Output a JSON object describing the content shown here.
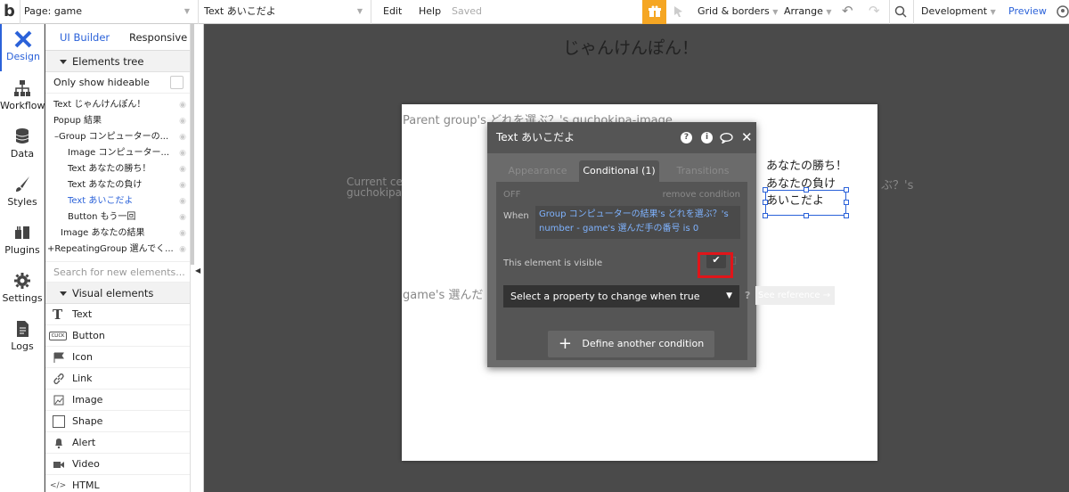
{
  "topbar": {
    "logo": "b",
    "page_label": "Page: game",
    "element_label": "Text あいこだよ",
    "edit": "Edit",
    "help": "Help",
    "saved": "Saved",
    "grid": "Grid & borders",
    "arrange": "Arrange",
    "development": "Development",
    "preview": "Preview"
  },
  "leftnav": [
    "Design",
    "Workflow",
    "Data",
    "Styles",
    "Plugins",
    "Settings",
    "Logs"
  ],
  "panel": {
    "tab_ui": "UI Builder",
    "tab_responsive": "Responsive",
    "elements_tree": "Elements tree",
    "only_hideable": "Only show hideable",
    "tree": [
      "Text じゃんけんぽん！",
      "Popup 結果",
      "Group コンピューターの...",
      "Image コンピューター...",
      "Text あなたの勝ち！",
      "Text あなたの負け",
      "Text あいこだよ",
      "Button もう一回",
      "Image あなたの結果",
      "RepeatingGroup 選んでく..."
    ],
    "search_placeholder": "Search for new elements...",
    "visual_elements": "Visual elements",
    "visual": [
      "Text",
      "Button",
      "Icon",
      "Link",
      "Image",
      "Shape",
      "Alert",
      "Video",
      "HTML"
    ],
    "button_icon_text": "CLICK"
  },
  "canvas": {
    "title": "じゃんけんぽん！",
    "parent_group": "Parent group's どれを選ぶ？'s guchokipa-image",
    "current_cell_1": "Current ce",
    "current_cell_2": "guchokipa",
    "right_trunc_1": "ぶ？'s",
    "games_chosen": "game's 選んだ",
    "win": "あなたの勝ち！",
    "lose": "あなたの負け",
    "draw": "あいこだよ"
  },
  "dialog": {
    "title": "Text あいこだよ",
    "tab_appearance": "Appearance",
    "tab_conditional": "Conditional (1)",
    "tab_transitions": "Transitions",
    "off": "OFF",
    "remove": "remove condition",
    "when": "When",
    "condition": "Group コンピューターの結果's どれを選ぶ？'s number - game's 選んだ手の番号 is 0",
    "visible_label": "This element is visible",
    "select_property": "Select a property to change when true",
    "see_reference": "See reference →",
    "define_another": "Define another condition"
  },
  "colors": {
    "accent": "#2b62d9",
    "highlight": "#e0151a",
    "gift": "#f5a623"
  }
}
